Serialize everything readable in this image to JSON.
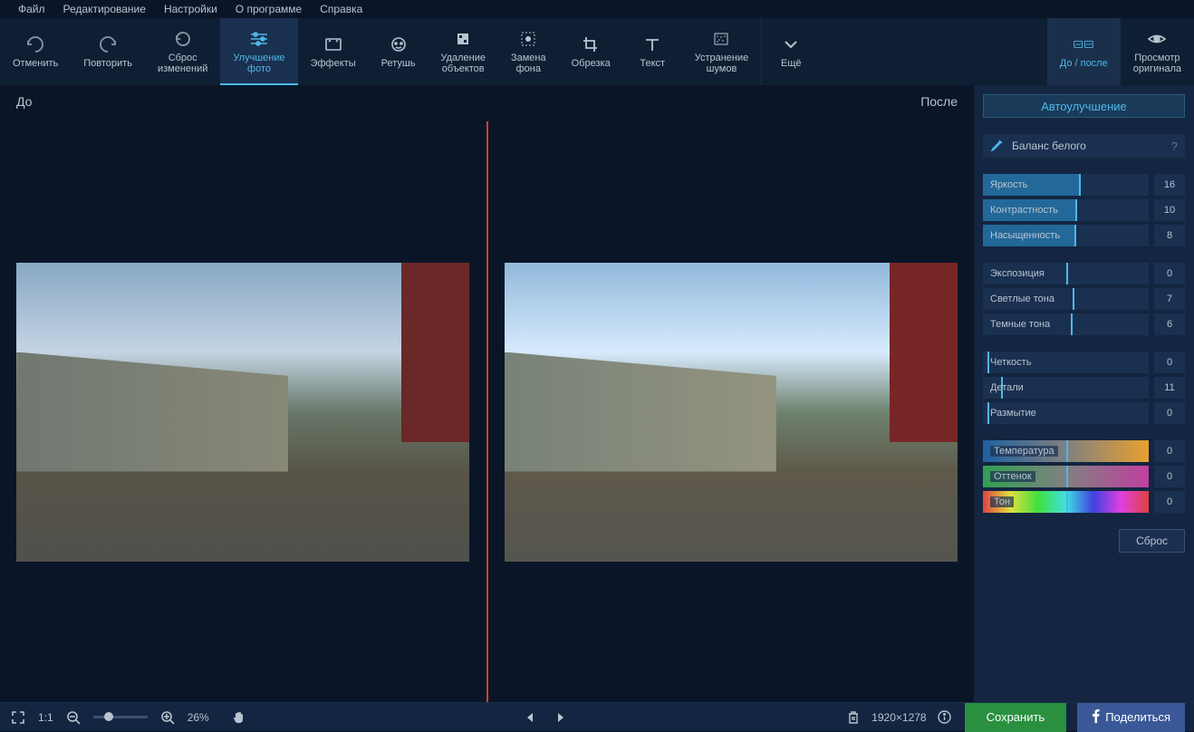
{
  "menubar": {
    "file": "Файл",
    "edit": "Редактирование",
    "settings": "Настройки",
    "about": "О программе",
    "help": "Справка"
  },
  "toolbar": {
    "undo": "Отменить",
    "redo": "Повторить",
    "reset_changes": "Сброс\nизменений",
    "enhance": "Улучшение\nфото",
    "effects": "Эффекты",
    "retouch": "Ретушь",
    "remove_objects": "Удаление\nобъектов",
    "replace_bg": "Замена\nфона",
    "crop": "Обрезка",
    "text": "Текст",
    "denoise": "Устранение\nшумов",
    "more": "Ещё",
    "before_after": "До / после",
    "view_original": "Просмотр\nоригинала"
  },
  "preview": {
    "before": "До",
    "after": "После"
  },
  "panel": {
    "auto_enhance": "Автоулучшение",
    "white_balance": "Баланс белого",
    "help": "?",
    "sliders": {
      "brightness": {
        "label": "Яркость",
        "value": "16",
        "pos": 58
      },
      "contrast": {
        "label": "Контрастность",
        "value": "10",
        "pos": 56
      },
      "saturation": {
        "label": "Насыщенность",
        "value": "8",
        "pos": 55
      },
      "exposure": {
        "label": "Экспозиция",
        "value": "0",
        "pos": 50
      },
      "highlights": {
        "label": "Светлые тона",
        "value": "7",
        "pos": 54
      },
      "shadows": {
        "label": "Темные тона",
        "value": "6",
        "pos": 53
      },
      "sharpness": {
        "label": "Четкость",
        "value": "0",
        "pos": 3
      },
      "details": {
        "label": "Детали",
        "value": "11",
        "pos": 11
      },
      "blur": {
        "label": "Размытие",
        "value": "0",
        "pos": 3
      },
      "temperature": {
        "label": "Температура",
        "value": "0",
        "pos": 50
      },
      "tint": {
        "label": "Оттенок",
        "value": "0",
        "pos": 50
      },
      "hue": {
        "label": "Тон",
        "value": "0",
        "pos": 50
      }
    },
    "reset": "Сброс"
  },
  "bottombar": {
    "fit": "1:1",
    "zoom": "26%",
    "dimensions": "1920×1278",
    "save": "Сохранить",
    "share": "Поделиться"
  }
}
